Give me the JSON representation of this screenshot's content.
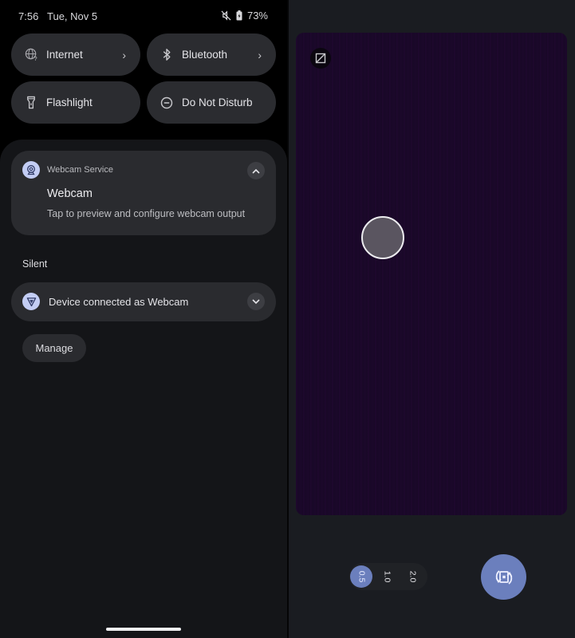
{
  "status_bar": {
    "time": "7:56",
    "date": "Tue, Nov 5",
    "battery_percent": "73%",
    "icons": [
      "mute-icon",
      "battery-charging-icon"
    ]
  },
  "quick_settings": {
    "tiles": [
      {
        "label": "Internet",
        "icon": "globe-question-icon",
        "has_chevron": true
      },
      {
        "label": "Bluetooth",
        "icon": "bluetooth-icon",
        "has_chevron": true
      },
      {
        "label": "Flashlight",
        "icon": "flashlight-icon",
        "has_chevron": false
      },
      {
        "label": "Do Not Disturb",
        "icon": "do-not-disturb-icon",
        "has_chevron": false
      }
    ],
    "chevron_glyph": "›"
  },
  "notifications": {
    "webcam_service": {
      "app_name": "Webcam Service",
      "title": "Webcam",
      "text": "Tap to preview and configure webcam output",
      "icon": "webcam-icon"
    },
    "silent_section": {
      "label": "Silent",
      "item": {
        "text": "Device connected as Webcam",
        "icon": "usb-shield-icon"
      }
    },
    "manage_label": "Manage"
  },
  "camera_preview": {
    "hdr_icon": "hdr-off-icon",
    "zoom_options": [
      "0.5",
      "1.0",
      "2.0"
    ],
    "selected_zoom": "0.5",
    "switch_camera_icon": "switch-camera-icon"
  },
  "colors": {
    "accent": "#6b7fbd",
    "app_icon_bg": "#c3cdf4",
    "card_bg": "#2a2b2f",
    "shade_bg": "#141518",
    "preview_bg": "#1a0828"
  }
}
